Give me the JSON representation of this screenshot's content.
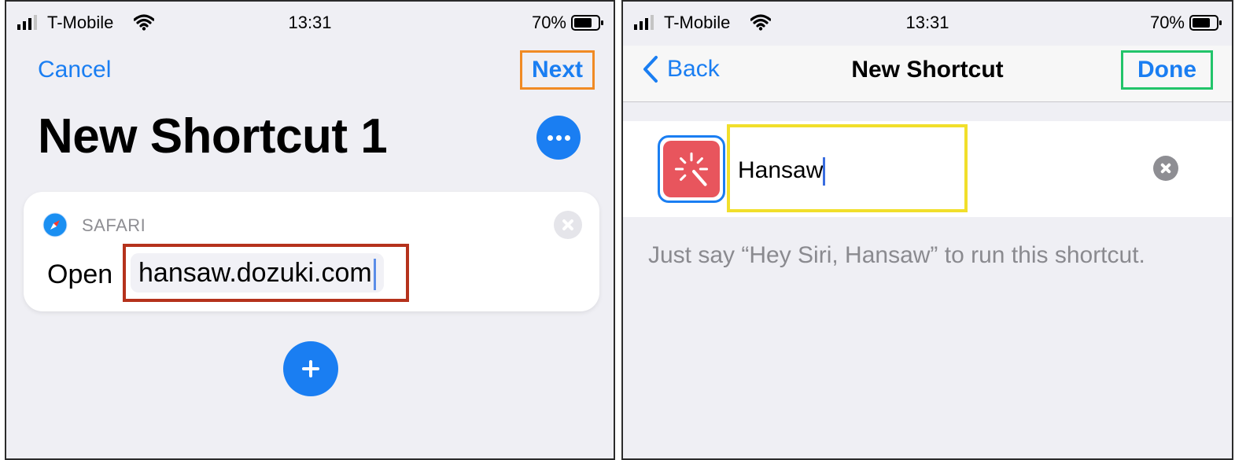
{
  "left": {
    "status": {
      "carrier": "T-Mobile",
      "time": "13:31",
      "battery": "70%"
    },
    "nav": {
      "cancel_label": "Cancel",
      "next_label": "Next"
    },
    "title": "New Shortcut 1",
    "action": {
      "app_label": "SAFARI",
      "verb": "Open",
      "url": "hansaw.dozuki.com"
    }
  },
  "right": {
    "status": {
      "carrier": "T-Mobile",
      "time": "13:31",
      "battery": "70%"
    },
    "nav": {
      "back_label": "Back",
      "title": "New Shortcut",
      "done_label": "Done"
    },
    "name_field": {
      "value": "Hansaw"
    },
    "hint": "Just say “Hey Siri, Hansaw” to run this shortcut."
  },
  "icons": [
    "signal-icon",
    "wifi-icon",
    "battery-icon",
    "more-icon",
    "safari-icon",
    "remove-action-icon",
    "add-action-icon",
    "back-chevron-icon",
    "shortcut-app-icon",
    "clear-text-icon"
  ],
  "colors": {
    "accent": "#1a7ef2",
    "next_highlight": "#f08a24",
    "url_highlight": "#b5321c",
    "name_highlight": "#f1df2b",
    "done_highlight": "#22c46a",
    "shortcut_icon": "#e8555d"
  }
}
